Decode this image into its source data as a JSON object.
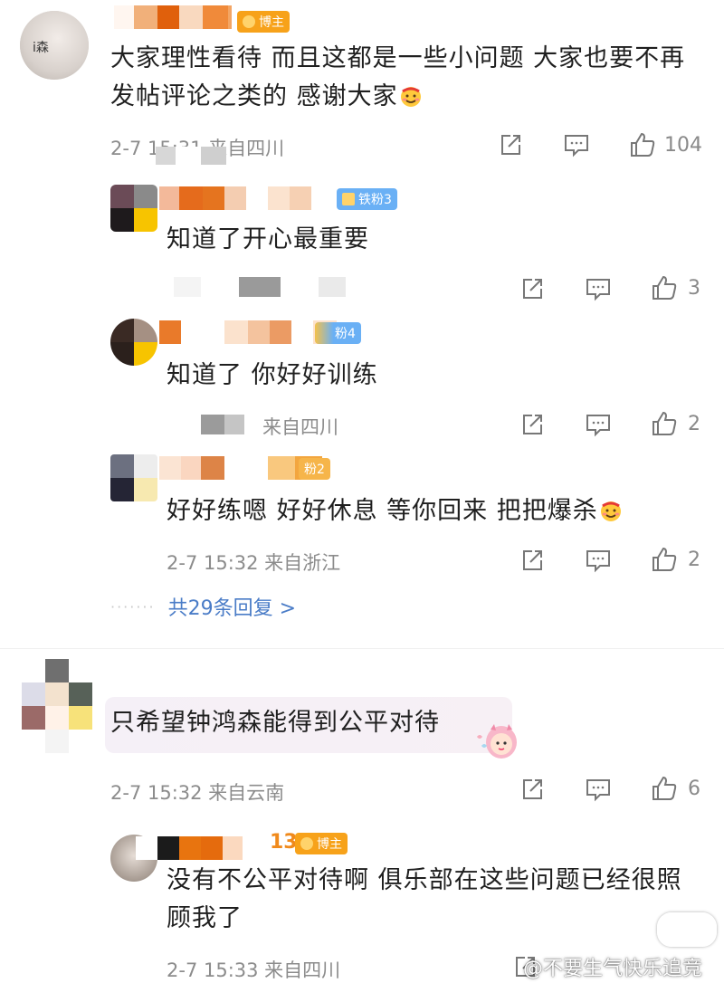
{
  "comments": [
    {
      "badge": "博主",
      "text": "大家理性看待 而且这都是一些小问题 大家也要不再发帖评论之类的 感谢大家",
      "meta": "2-7 15:31 来自四川",
      "likes": "104",
      "replies": [
        {
          "badge": "铁粉3",
          "text": "知道了开心最重要",
          "meta": "",
          "likes": "3"
        },
        {
          "badge": "粉4",
          "text": "知道了 你好好训练",
          "meta": "来自四川",
          "likes": "2"
        },
        {
          "badge": "粉2",
          "text": "好好练嗯 好好休息 等你回来 把把爆杀",
          "meta": "2-7 15:32 来自浙江",
          "likes": "2"
        }
      ],
      "more_replies": "共29条回复 >"
    },
    {
      "text": "只希望钟鸿森能得到公平对待",
      "meta": "2-7 15:32 来自云南",
      "likes": "6",
      "replies": [
        {
          "badge": "博主",
          "text": "没有不公平对待啊 俱乐部在这些问题已经很照顾我了",
          "meta": "2-7 15:33 来自四川",
          "likes": ""
        }
      ]
    }
  ],
  "avatar_text": "i森",
  "watermark": "@不要生气快乐追竞",
  "icons": [
    "share-icon",
    "comment-icon",
    "like-icon",
    "blush-emoji",
    "cartoon-sticker",
    "crown-icon"
  ],
  "colors": {
    "blogger_badge": "#f7a21a",
    "fan_badge": "#6ab0f5",
    "link": "#4a7cc7",
    "meta": "#8c8c8c"
  }
}
